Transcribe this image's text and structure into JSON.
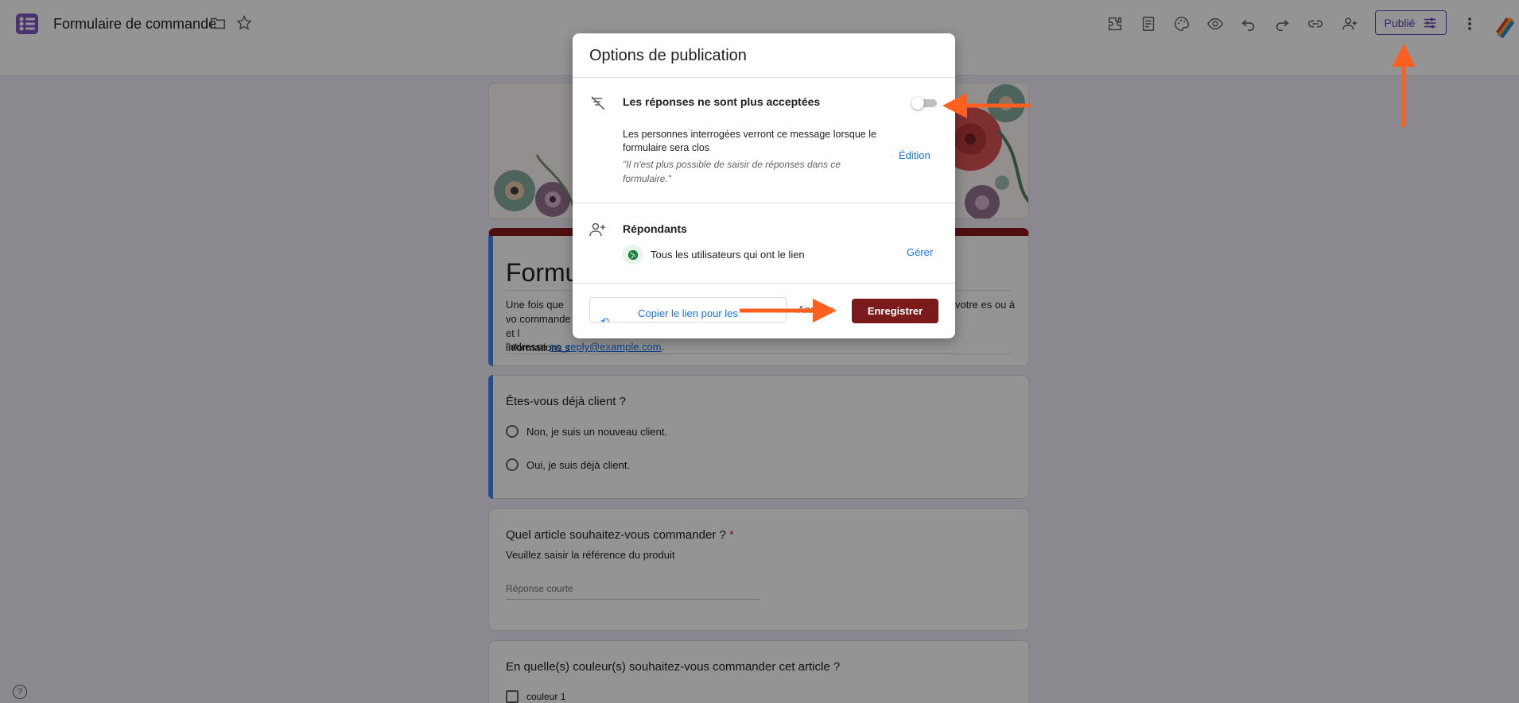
{
  "header": {
    "doc_title": "Formulaire de commande",
    "publish_label": "Publié"
  },
  "form": {
    "title": "Formul",
    "desc_left": "Une fois que vo commande et l informations s",
    "desc_right": "votre es ou à",
    "desc_bottom_prefix": "l'adresse ",
    "desc_email": "no_reply@example.com",
    "desc_bottom_suffix": "."
  },
  "questions": {
    "q1": {
      "title": "Êtes-vous déjà client ?",
      "options": [
        "Non, je suis un nouveau client.",
        "Oui, je suis déjà client."
      ]
    },
    "q2": {
      "title": "Quel article souhaitez-vous commander ?",
      "required_mark": "*",
      "help": "Veuillez saisir la référence du produit",
      "placeholder": "Réponse courte"
    },
    "q3": {
      "title": "En quelle(s) couleur(s) souhaitez-vous commander cet article ?",
      "options": [
        "couleur 1"
      ]
    }
  },
  "dialog": {
    "title": "Options de publication",
    "closed_label": "Les réponses ne sont plus acceptées",
    "closed_toggle_on": false,
    "closed_message": "Les personnes interrogées verront ce message lorsque le formulaire sera clos",
    "closed_quote": "\"Il n'est plus possible de saisir de réponses dans ce formulaire.\"",
    "edit_label": "Édition",
    "respondents_label": "Répondants",
    "respondents_value": "Tous les utilisateurs qui ont le lien",
    "manage_label": "Gérer",
    "copy_label": "Copier le lien pour les",
    "cancel_label": "Annuler",
    "save_label": "Enregistrer"
  },
  "colors": {
    "accent": "#673ab7",
    "save_button": "#7b1a1a",
    "annotation_arrow": "#ff5f1f",
    "link": "#1a73e8"
  },
  "icons": {
    "toolbar": [
      "puzzle-icon",
      "summary-icon",
      "palette-icon",
      "eye-icon",
      "undo-icon",
      "redo-icon",
      "link-icon",
      "add-person-icon"
    ]
  }
}
